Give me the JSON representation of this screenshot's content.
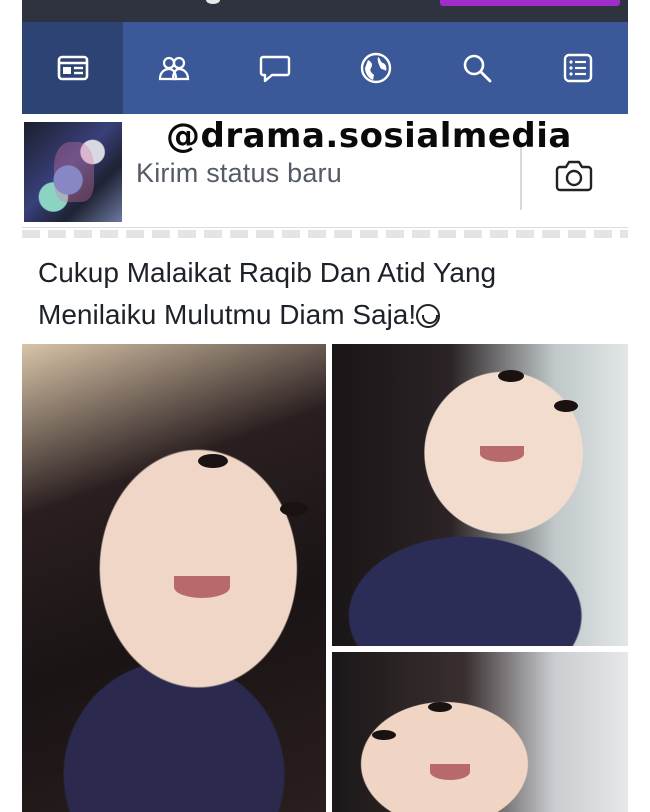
{
  "watermark": "@drama.sosialmedia",
  "nav": {
    "items": [
      {
        "name": "news-feed",
        "icon": "news-feed-icon",
        "active": true
      },
      {
        "name": "friends",
        "icon": "friends-icon",
        "active": false
      },
      {
        "name": "messages",
        "icon": "chat-bubble-icon",
        "active": false
      },
      {
        "name": "notifications",
        "icon": "globe-icon",
        "active": false
      },
      {
        "name": "search",
        "icon": "search-icon",
        "active": false
      },
      {
        "name": "menu",
        "icon": "list-menu-icon",
        "active": false
      }
    ],
    "colors": {
      "bar": "#3b5998",
      "active": "#2d4373",
      "icon": "#ffffff"
    }
  },
  "composer": {
    "placeholder": "Kirim status baru",
    "camera_icon": "camera-icon"
  },
  "post": {
    "text": "Cukup Malaikat Raqib Dan Atid Yang Menilaiku Mulutmu Diam Saja!",
    "emoji": "grinning-face-emoji"
  },
  "photos": [
    {
      "description": "selfie-1"
    },
    {
      "description": "selfie-2"
    },
    {
      "description": "selfie-3"
    }
  ]
}
